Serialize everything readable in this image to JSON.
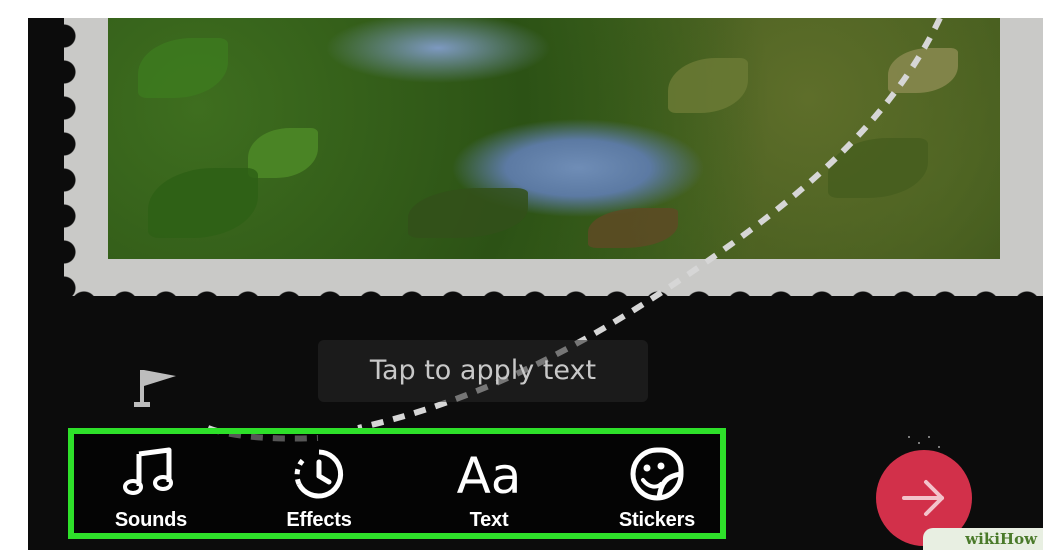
{
  "hint": {
    "text": "Tap to apply text"
  },
  "toolbar": {
    "items": [
      {
        "label": "Sounds",
        "icon": "music-note-icon"
      },
      {
        "label": "Effects",
        "icon": "timer-effects-icon"
      },
      {
        "label": "Text",
        "icon_text": "Aa",
        "icon": "text-aa-icon"
      },
      {
        "label": "Stickers",
        "icon": "sticker-face-icon"
      }
    ],
    "highlight_color": "#2ee02a"
  },
  "next_button": {
    "icon": "arrow-right-icon",
    "color": "#d2304a"
  },
  "watermark": {
    "text": "wikiHow"
  }
}
